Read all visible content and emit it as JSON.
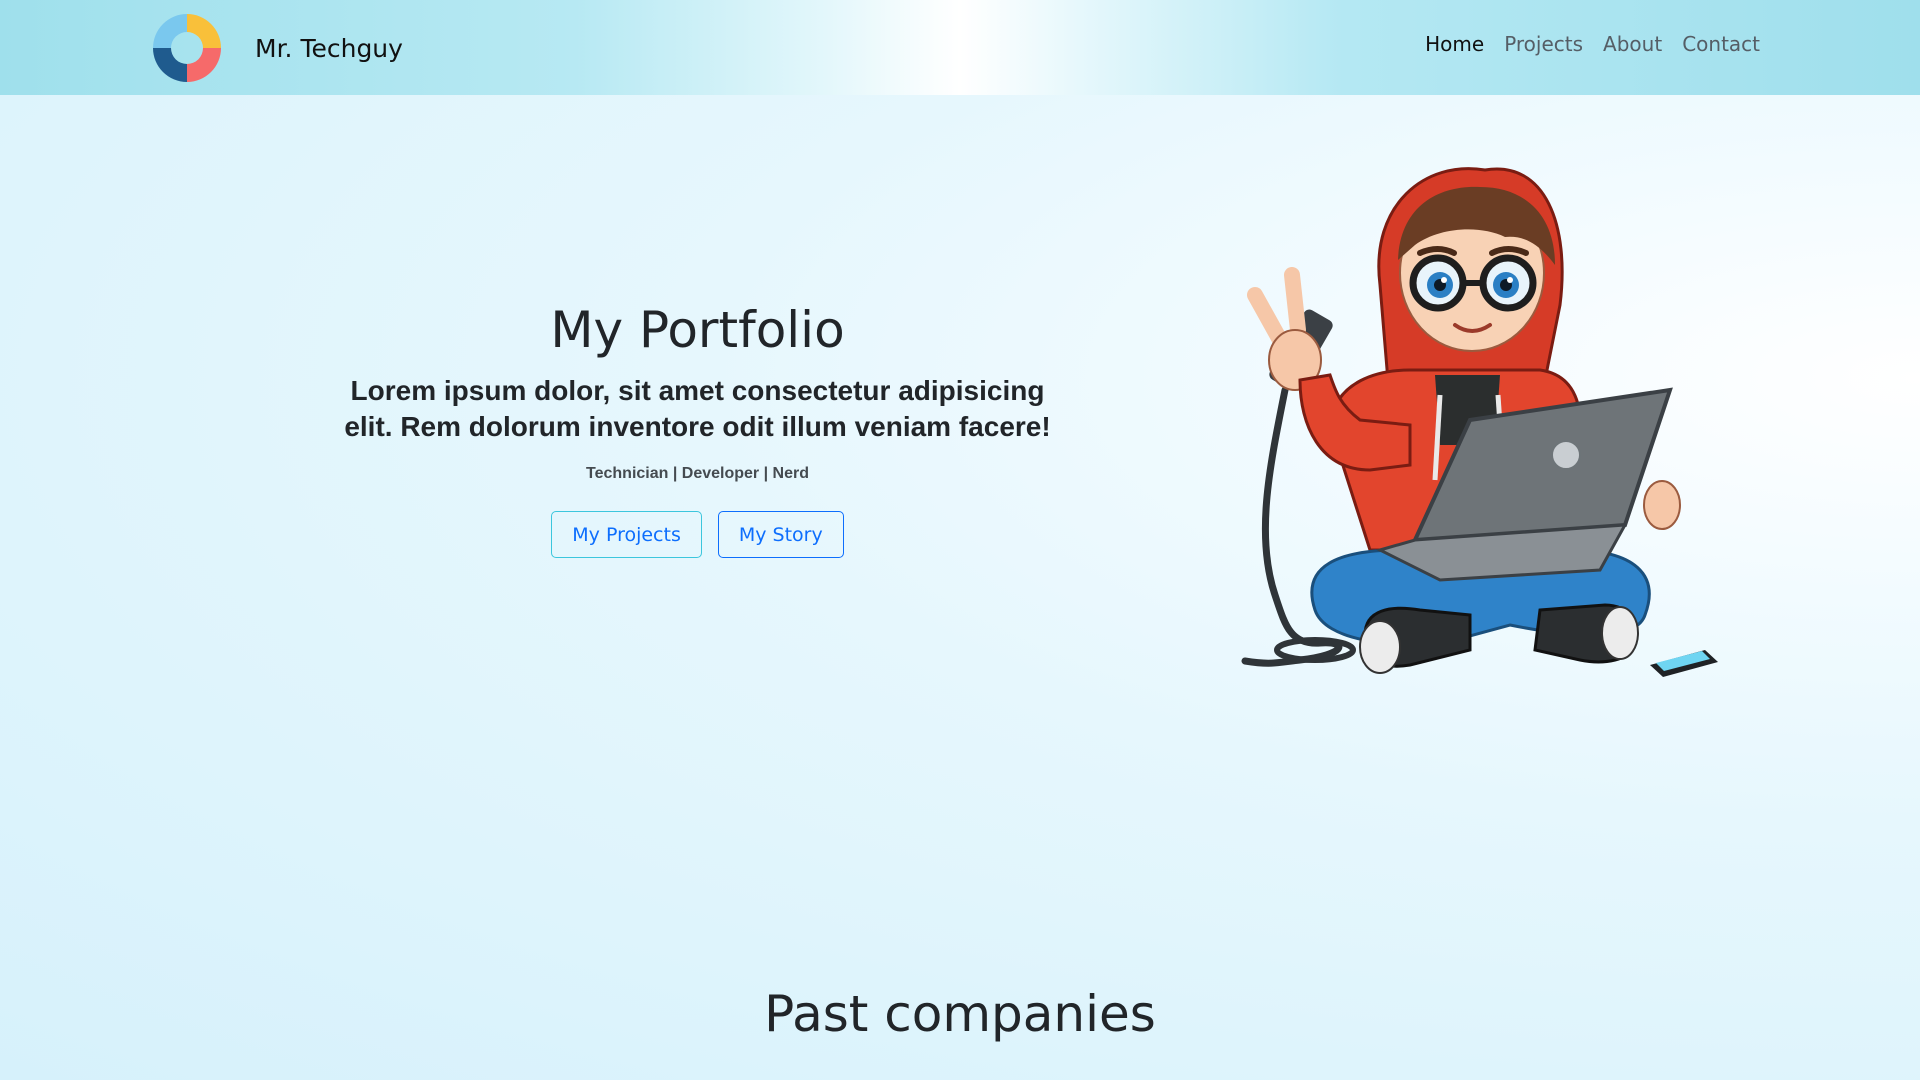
{
  "navbar": {
    "brand_name": "Mr. Techguy",
    "logo_icon": "donut-logo-icon",
    "logo_colors": [
      "#f9c03a",
      "#f66a6a",
      "#1f5b8e",
      "#7ac8ee"
    ],
    "links": [
      {
        "label": "Home",
        "active": true
      },
      {
        "label": "Projects",
        "active": false
      },
      {
        "label": "About",
        "active": false
      },
      {
        "label": "Contact",
        "active": false
      }
    ]
  },
  "hero": {
    "title": "My Portfolio",
    "subtitle": "Lorem ipsum dolor, sit amet consectetur adipisicing elit. Rem dolorum inventore odit illum veniam facere!",
    "tagline": "Technician | Developer | Nerd",
    "buttons": {
      "projects": "My Projects",
      "story": "My Story"
    },
    "illustration_icon": "developer-avatar-illustration"
  },
  "companies": {
    "title": "Past companies"
  },
  "colors": {
    "accent_blue": "#0d6efd",
    "accent_cyan": "#3cc6dd",
    "navbar_gradient": "#9fe0ec"
  }
}
